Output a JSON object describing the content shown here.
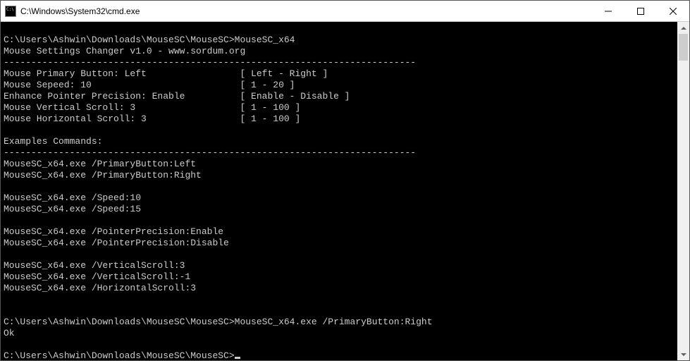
{
  "window": {
    "title": "C:\\Windows\\System32\\cmd.exe"
  },
  "console": {
    "prompt1": "C:\\Users\\Ashwin\\Downloads\\MouseSC\\MouseSC>",
    "cmd1": "MouseSC_x64",
    "header": "Mouse Settings Changer v1.0 - www.sordum.org",
    "dashline": "---------------------------------------------------------------------------",
    "settings": {
      "s1": "Mouse Primary Button: Left                 [ Left - Right ]",
      "s2": "Mouse Sepeed: 10                           [ 1 - 20 ]",
      "s3": "Enhance Pointer Precision: Enable          [ Enable - Disable ]",
      "s4": "Mouse Vertical Scroll: 3                   [ 1 - 100 ]",
      "s5": "Mouse Horizontal Scroll: 3                 [ 1 - 100 ]"
    },
    "examples_label": "Examples Commands:",
    "examples": {
      "e1": "MouseSC_x64.exe /PrimaryButton:Left",
      "e2": "MouseSC_x64.exe /PrimaryButton:Right",
      "e3": "MouseSC_x64.exe /Speed:10",
      "e4": "MouseSC_x64.exe /Speed:15",
      "e5": "MouseSC_x64.exe /PointerPrecision:Enable",
      "e6": "MouseSC_x64.exe /PointerPrecision:Disable",
      "e7": "MouseSC_x64.exe /VerticalScroll:3",
      "e8": "MouseSC_x64.exe /VerticalScroll:-1",
      "e9": "MouseSC_x64.exe /HorizontalScroll:3"
    },
    "prompt2": "C:\\Users\\Ashwin\\Downloads\\MouseSC\\MouseSC>",
    "cmd2": "MouseSC_x64.exe /PrimaryButton:Right",
    "result2": "Ok",
    "prompt3": "C:\\Users\\Ashwin\\Downloads\\MouseSC\\MouseSC>"
  }
}
